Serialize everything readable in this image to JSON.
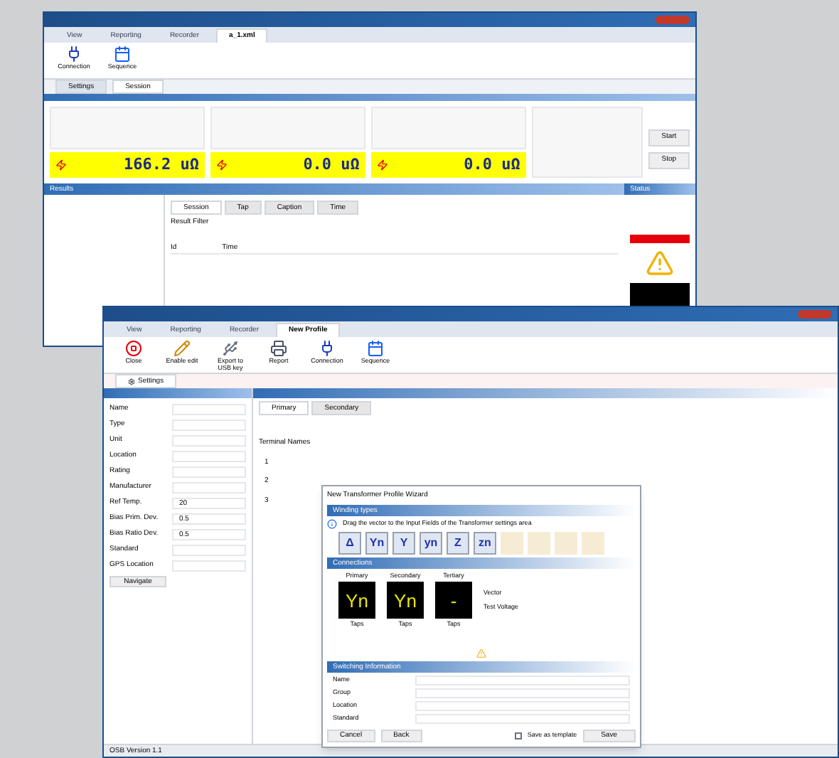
{
  "back_window": {
    "tabs": [
      {
        "label": "View",
        "selected": false
      },
      {
        "label": "Reporting",
        "selected": false
      },
      {
        "label": "Recorder",
        "selected": false
      },
      {
        "label": "a_1.xml",
        "selected": true
      }
    ],
    "ribbon": [
      {
        "label": "Connection",
        "kind": "plug"
      },
      {
        "label": "Sequence",
        "kind": "calendar"
      }
    ],
    "doc_tabs": [
      {
        "label": "Settings",
        "selected": false
      },
      {
        "label": "Session",
        "selected": true
      }
    ],
    "channels": [
      {
        "reading": "166.2 uΩ"
      },
      {
        "reading": "0.0 uΩ"
      },
      {
        "reading": "0.0 uΩ"
      }
    ],
    "side_buttons": [
      "Start",
      "Stop"
    ],
    "results_title": "Results",
    "result_tabs": [
      {
        "label": "Session",
        "selected": true
      },
      {
        "label": "Tap",
        "selected": false
      },
      {
        "label": "Caption",
        "selected": false
      },
      {
        "label": "Time",
        "selected": false
      }
    ],
    "filter_label": "Result Filter",
    "columns": [
      "Id",
      "Time"
    ],
    "status_title": "Status"
  },
  "front_window": {
    "tabs": [
      {
        "label": "View",
        "selected": false
      },
      {
        "label": "Reporting",
        "selected": false
      },
      {
        "label": "Recorder",
        "selected": false
      },
      {
        "label": "New Profile",
        "selected": true
      }
    ],
    "ribbon": [
      {
        "label": "Close",
        "kind": "close"
      },
      {
        "label": "Enable edit",
        "kind": "pencil"
      },
      {
        "label": "Export to USB key",
        "kind": "usb"
      },
      {
        "label": "Report",
        "kind": "printer"
      },
      {
        "label": "Connection",
        "kind": "plug"
      },
      {
        "label": "Sequence",
        "kind": "calendar"
      }
    ],
    "doc_tab": "Settings",
    "fields": [
      {
        "label": "Name"
      },
      {
        "label": "Type"
      },
      {
        "label": "Unit"
      },
      {
        "label": "Location"
      },
      {
        "label": "Rating"
      },
      {
        "label": "Manufacturer"
      },
      {
        "label": "Ref Temp.",
        "value": "20"
      },
      {
        "label": "Bias Prim. Dev.",
        "value": "0.5"
      },
      {
        "label": "Bias Ratio Dev.",
        "value": "0.5"
      },
      {
        "label": "Standard"
      },
      {
        "label": "GPS Location"
      }
    ],
    "navigate_button": "Navigate",
    "mid_tabs": [
      {
        "label": "Primary",
        "selected": true
      },
      {
        "label": "Secondary",
        "selected": false
      }
    ],
    "terminal_label": "Terminal Names",
    "terminals": [
      "1",
      "2",
      "3"
    ],
    "status_bar": "OSB Version 1.1"
  },
  "wizard": {
    "title": "New Transformer Profile Wizard",
    "sections": [
      "Winding types",
      "Connections",
      "Switching Information"
    ],
    "hint": "Drag the vector to the Input Fields of the Transformer settings area",
    "vectors": [
      "Δ",
      "Yn",
      "Y",
      "yn",
      "Z",
      "zn"
    ],
    "windings": [
      {
        "label": "Primary",
        "symbol": "Yn",
        "taps": "Taps"
      },
      {
        "label": "Secondary",
        "symbol": "Yn",
        "taps": "Taps"
      },
      {
        "label": "Tertiary",
        "symbol": "-",
        "taps": "Taps"
      }
    ],
    "vector_label": "Vector",
    "voltage_label": "Test Voltage",
    "info_rows": [
      {
        "label": "Name"
      },
      {
        "label": "Group"
      },
      {
        "label": "Location"
      },
      {
        "label": "Standard"
      }
    ],
    "buttons": {
      "cancel": "Cancel",
      "back": "Back",
      "save": "Save"
    },
    "template": {
      "label": "Save as template",
      "checked": false
    }
  }
}
